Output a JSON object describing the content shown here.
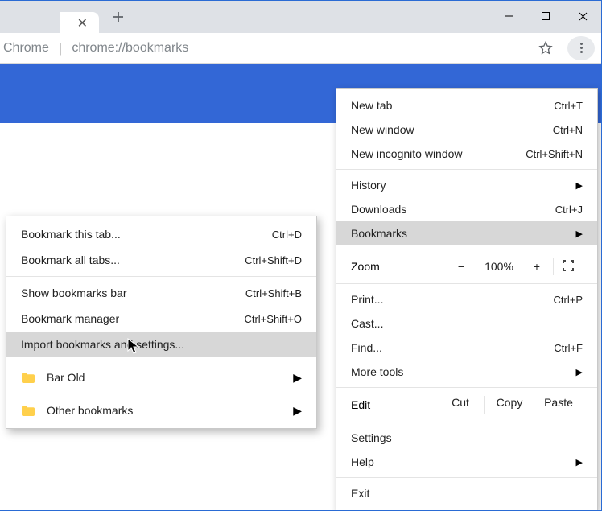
{
  "toolbar": {
    "extension_label": "Chrome",
    "url": "chrome://bookmarks"
  },
  "main_menu": {
    "new_tab": {
      "label": "New tab",
      "accel": "Ctrl+T"
    },
    "new_window": {
      "label": "New window",
      "accel": "Ctrl+N"
    },
    "incognito": {
      "label": "New incognito window",
      "accel": "Ctrl+Shift+N"
    },
    "history": {
      "label": "History"
    },
    "downloads": {
      "label": "Downloads",
      "accel": "Ctrl+J"
    },
    "bookmarks": {
      "label": "Bookmarks"
    },
    "zoom": {
      "label": "Zoom",
      "minus": "−",
      "pct": "100%",
      "plus": "+"
    },
    "print": {
      "label": "Print...",
      "accel": "Ctrl+P"
    },
    "cast": {
      "label": "Cast..."
    },
    "find": {
      "label": "Find...",
      "accel": "Ctrl+F"
    },
    "more_tools": {
      "label": "More tools"
    },
    "edit": {
      "label": "Edit",
      "cut": "Cut",
      "copy": "Copy",
      "paste": "Paste"
    },
    "settings": {
      "label": "Settings"
    },
    "help": {
      "label": "Help"
    },
    "exit": {
      "label": "Exit"
    }
  },
  "bookmarks_menu": {
    "bookmark_tab": {
      "label": "Bookmark this tab...",
      "accel": "Ctrl+D"
    },
    "bookmark_all": {
      "label": "Bookmark all tabs...",
      "accel": "Ctrl+Shift+D"
    },
    "show_bar": {
      "label": "Show bookmarks bar",
      "accel": "Ctrl+Shift+B"
    },
    "manager": {
      "label": "Bookmark manager",
      "accel": "Ctrl+Shift+O"
    },
    "import": {
      "label": "Import bookmarks and settings..."
    },
    "folders": [
      {
        "label": "Bar Old"
      },
      {
        "label": "Other bookmarks"
      }
    ]
  }
}
